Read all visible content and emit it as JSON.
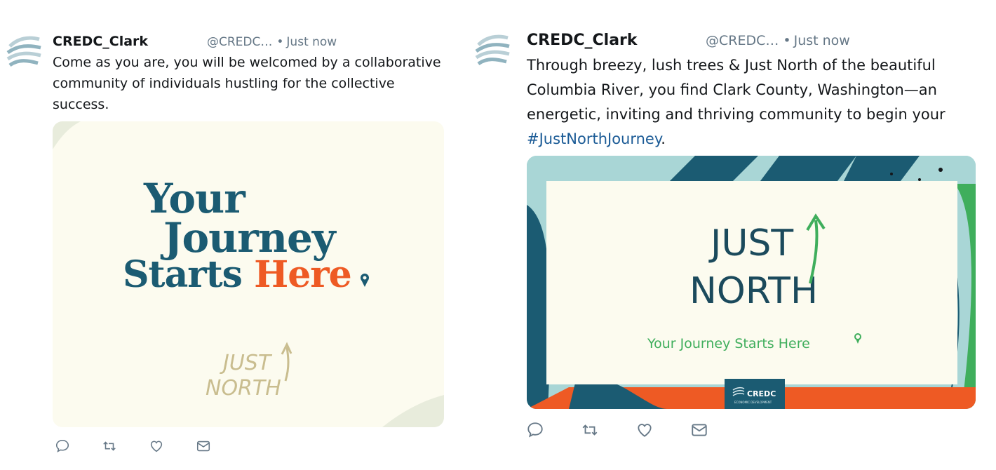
{
  "tweets": [
    {
      "author_name": "CREDC_Clark",
      "handle": "@CREDC…",
      "separator": "•",
      "time": "Just now",
      "text": "Come as you are, you will be welcomed by a collaborative community of individuals hustling for the collective success.",
      "media": {
        "headline_line1": "Your",
        "headline_line2": "Journey",
        "headline_line3a": "Starts ",
        "headline_line3b": "Here",
        "logo_line1": "JUST",
        "logo_line2": "NORTH"
      },
      "actions": [
        "reply-icon",
        "retweet-icon",
        "like-icon",
        "message-icon"
      ]
    },
    {
      "author_name": "CREDC_Clark",
      "handle": "@CREDC…",
      "separator": "•",
      "time": "Just now",
      "text_before": "Through breezy, lush trees & Just North of the beautiful Columbia River, you find Clark County, Washington—an energetic, inviting and thriving community to begin your ",
      "hashtag": "#JustNorthJourney",
      "text_after": ".",
      "media": {
        "logo_line1": "JUST",
        "logo_line2": "NORTH",
        "tagline": "Your Journey Starts Here",
        "badge": "CREDC",
        "badge_sub": "ECONOMIC DEVELOPMENT"
      },
      "actions": [
        "reply-icon",
        "retweet-icon",
        "like-icon",
        "message-icon"
      ]
    }
  ],
  "colors": {
    "brand_teal": "#1b5b72",
    "brand_orange": "#ee5a24",
    "brand_green": "#3fae5c",
    "logo_gold": "#c9bd8f",
    "link": "#1b5b96",
    "muted": "#657786"
  }
}
